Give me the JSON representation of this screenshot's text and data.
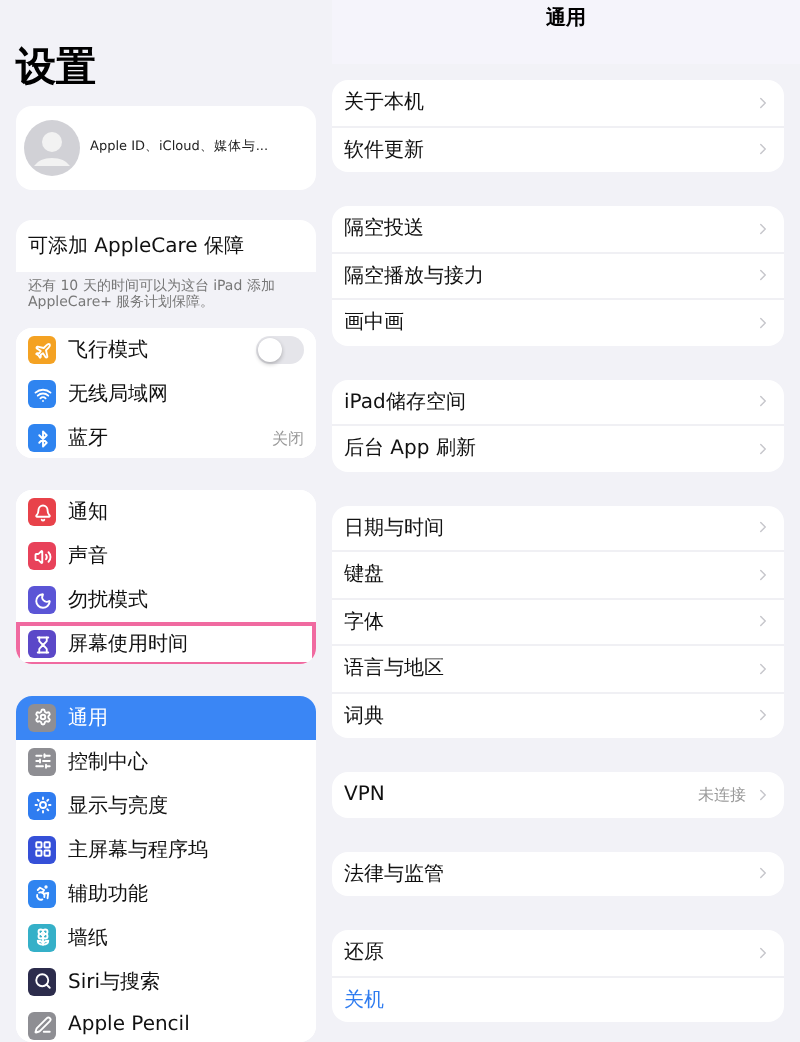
{
  "sidebar": {
    "title": "设置",
    "profile": {
      "subtitle": "Apple ID、iCloud、媒体与..."
    },
    "applecare": {
      "title": "可添加 AppleCare 保障",
      "description": "还有 10 天的时间可以为这台 iPad 添加 AppleCare+ 服务计划保障。"
    },
    "groups": [
      [
        {
          "kind": "toggle",
          "label": "飞行模式",
          "color": "#f4a223",
          "on": false,
          "selected": false,
          "highlighted": false
        },
        {
          "kind": "plain",
          "label": "无线局域网",
          "color": "#2f84f0",
          "selected": false,
          "highlighted": false
        },
        {
          "kind": "value",
          "label": "蓝牙",
          "value": "关闭",
          "color": "#2f84f0",
          "selected": false,
          "highlighted": false
        }
      ],
      [
        {
          "kind": "plain",
          "label": "通知",
          "color": "#e8424a",
          "selected": false,
          "highlighted": false
        },
        {
          "kind": "plain",
          "label": "声音",
          "color": "#e8425a",
          "selected": false,
          "highlighted": false
        },
        {
          "kind": "plain",
          "label": "勿扰模式",
          "color": "#5b55d6",
          "selected": false,
          "highlighted": false
        },
        {
          "kind": "plain",
          "label": "屏幕使用时间",
          "color": "#5b48c8",
          "selected": false,
          "highlighted": true
        }
      ],
      [
        {
          "kind": "plain",
          "label": "通用",
          "color": "#8e8e93",
          "selected": true,
          "highlighted": false
        },
        {
          "kind": "plain",
          "label": "控制中心",
          "color": "#8e8e93",
          "selected": false,
          "highlighted": false
        },
        {
          "kind": "plain",
          "label": "显示与亮度",
          "color": "#2f7cf0",
          "selected": false,
          "highlighted": false
        },
        {
          "kind": "plain",
          "label": "主屏幕与程序坞",
          "color": "#3550d8",
          "selected": false,
          "highlighted": false
        },
        {
          "kind": "plain",
          "label": "辅助功能",
          "color": "#2f84f0",
          "selected": false,
          "highlighted": false
        },
        {
          "kind": "plain",
          "label": "墙纸",
          "color": "#35b0c8",
          "selected": false,
          "highlighted": false
        },
        {
          "kind": "plain",
          "label": "Siri与搜索",
          "color": "#2c2c4c",
          "selected": false,
          "highlighted": false
        },
        {
          "kind": "plain",
          "label": "Apple Pencil",
          "color": "#8e8e93",
          "selected": false,
          "highlighted": false
        }
      ]
    ]
  },
  "detail": {
    "title": "通用",
    "groups": [
      [
        {
          "kind": "link",
          "label": "关于本机"
        },
        {
          "kind": "link",
          "label": "软件更新"
        }
      ],
      [
        {
          "kind": "link",
          "label": "隔空投送"
        },
        {
          "kind": "link",
          "label": "隔空播放与接力"
        },
        {
          "kind": "link",
          "label": "画中画"
        }
      ],
      [
        {
          "kind": "link",
          "label": "iPad储存空间"
        },
        {
          "kind": "link",
          "label": "后台 App 刷新"
        }
      ],
      [
        {
          "kind": "link",
          "label": "日期与时间"
        },
        {
          "kind": "link",
          "label": "键盘"
        },
        {
          "kind": "link",
          "label": "字体"
        },
        {
          "kind": "link",
          "label": "语言与地区"
        },
        {
          "kind": "link",
          "label": "词典"
        }
      ],
      [
        {
          "kind": "value",
          "label": "VPN",
          "value": "未连接"
        }
      ],
      [
        {
          "kind": "link",
          "label": "法律与监管"
        }
      ],
      [
        {
          "kind": "link",
          "label": "还原"
        },
        {
          "kind": "action",
          "label": "关机"
        }
      ]
    ]
  }
}
